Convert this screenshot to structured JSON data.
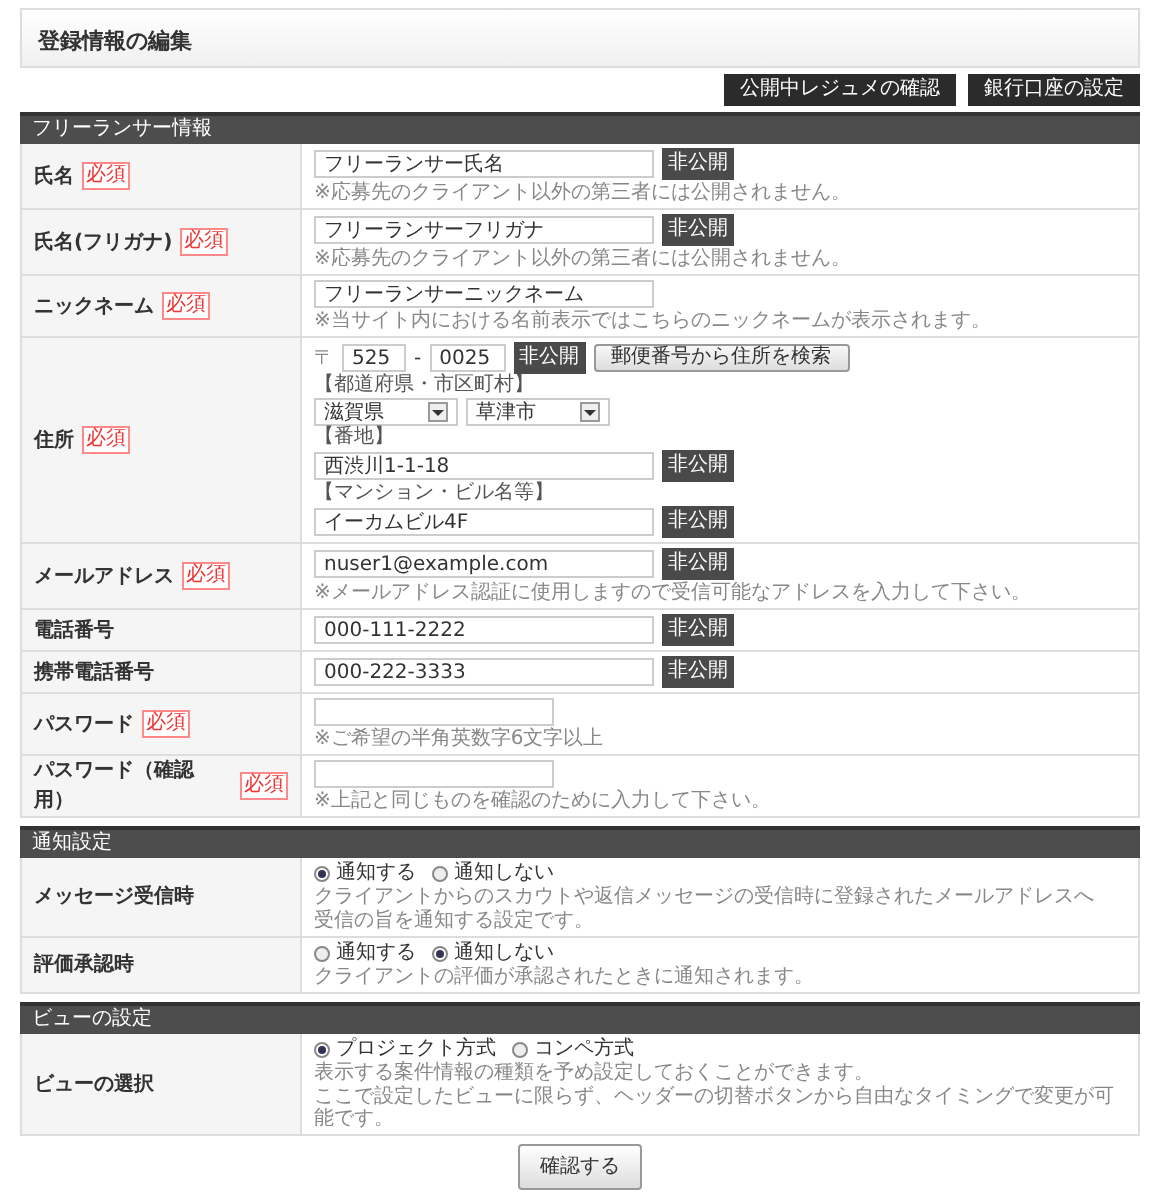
{
  "title": "登録情報の編集",
  "top_buttons": [
    "公開中レジュメの確認",
    "銀行口座の設定"
  ],
  "sections": [
    {
      "title": "フリーランサー情報",
      "rows": [
        {
          "label": "氏名",
          "required": "必須",
          "items": [
            {
              "kind": "input",
              "value": "フリーランサー氏名",
              "badge": "非公開"
            },
            {
              "kind": "note",
              "text": "※応募先のクライアント以外の第三者には公開されません。"
            }
          ]
        },
        {
          "label": "氏名(フリガナ)",
          "required": "必須",
          "items": [
            {
              "kind": "input",
              "value": "フリーランサーフリガナ",
              "badge": "非公開"
            },
            {
              "kind": "note",
              "text": "※応募先のクライアント以外の第三者には公開されません。"
            }
          ]
        },
        {
          "label": "ニックネーム",
          "required": "必須",
          "items": [
            {
              "kind": "input",
              "value": "フリーランサーニックネーム"
            },
            {
              "kind": "note",
              "text": "※当サイト内における名前表示ではこちらのニックネームが表示されます。"
            }
          ]
        },
        {
          "label": "住所",
          "required": "必須",
          "items": [
            {
              "kind": "postal",
              "mark": "〒",
              "first": "525",
              "dash": "-",
              "second": "0025",
              "badge": "非公開",
              "button": "郵便番号から住所を検索"
            },
            {
              "kind": "caption",
              "text": "【都道府県・市区町村】"
            },
            {
              "kind": "selects",
              "options": [
                "滋賀県",
                "草津市"
              ]
            },
            {
              "kind": "caption",
              "text": "【番地】"
            },
            {
              "kind": "input",
              "value": "西渋川1-1-18",
              "badge": "非公開"
            },
            {
              "kind": "caption",
              "text": "【マンション・ビル名等】"
            },
            {
              "kind": "input",
              "value": "イーカムビル4F",
              "badge": "非公開"
            }
          ]
        },
        {
          "label": "メールアドレス",
          "required": "必須",
          "items": [
            {
              "kind": "input",
              "value": "nuser1@example.com",
              "badge": "非公開"
            },
            {
              "kind": "note",
              "text": "※メールアドレス認証に使用しますので受信可能なアドレスを入力して下さい。"
            }
          ]
        },
        {
          "label": "電話番号",
          "items": [
            {
              "kind": "input",
              "value": "000-111-2222",
              "badge": "非公開"
            }
          ]
        },
        {
          "label": "携帯電話番号",
          "items": [
            {
              "kind": "input",
              "value": "000-222-3333",
              "badge": "非公開"
            }
          ]
        },
        {
          "label": "パスワード",
          "required": "必須",
          "items": [
            {
              "kind": "password"
            },
            {
              "kind": "note",
              "text": "※ご希望の半角英数字6文字以上"
            }
          ]
        },
        {
          "label": "パスワード（確認用）",
          "required": "必須",
          "items": [
            {
              "kind": "password"
            },
            {
              "kind": "note",
              "text": "※上記と同じものを確認のために入力して下さい。"
            }
          ]
        }
      ]
    },
    {
      "title": "通知設定",
      "rows": [
        {
          "label": "メッセージ受信時",
          "items": [
            {
              "kind": "radios",
              "options": [
                {
                  "label": "通知する",
                  "selected": true
                },
                {
                  "label": "通知しない",
                  "selected": false
                }
              ]
            },
            {
              "kind": "note",
              "text": "クライアントからのスカウトや返信メッセージの受信時に登録されたメールアドレスへ"
            },
            {
              "kind": "note",
              "text": "受信の旨を通知する設定です。"
            }
          ]
        },
        {
          "label": "評価承認時",
          "items": [
            {
              "kind": "radios",
              "options": [
                {
                  "label": "通知する",
                  "selected": false
                },
                {
                  "label": "通知しない",
                  "selected": true
                }
              ]
            },
            {
              "kind": "note",
              "text": "クライアントの評価が承認されたときに通知されます。"
            }
          ]
        }
      ]
    },
    {
      "title": "ビューの設定",
      "rows": [
        {
          "label": "ビューの選択",
          "items": [
            {
              "kind": "radios",
              "options": [
                {
                  "label": "プロジェクト方式",
                  "selected": true
                },
                {
                  "label": "コンペ方式",
                  "selected": false
                }
              ]
            },
            {
              "kind": "note",
              "text": "表示する案件情報の種類を予め設定しておくことができます。"
            },
            {
              "kind": "note",
              "text": "ここで設定したビューに限らず、ヘッダーの切替ボタンから自由なタイミングで変更が可能です。"
            }
          ]
        }
      ]
    }
  ],
  "submit": "確認する"
}
